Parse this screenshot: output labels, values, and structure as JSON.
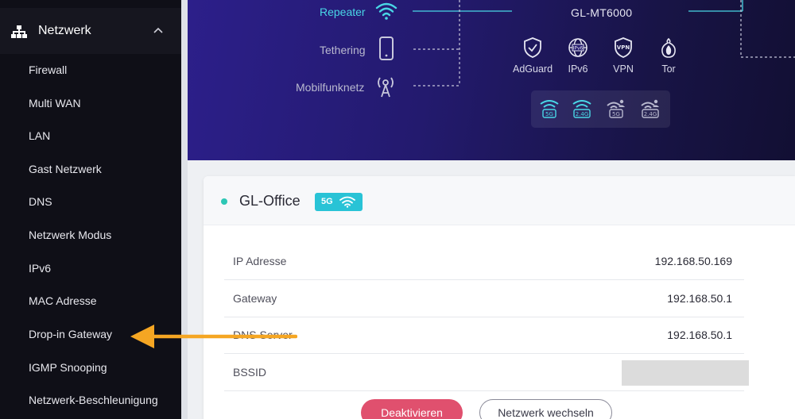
{
  "sidebar": {
    "section_title": "Netzwerk",
    "items": [
      {
        "label": "Firewall"
      },
      {
        "label": "Multi WAN"
      },
      {
        "label": "LAN"
      },
      {
        "label": "Gast Netzwerk"
      },
      {
        "label": "DNS"
      },
      {
        "label": "Netzwerk Modus"
      },
      {
        "label": "IPv6"
      },
      {
        "label": "MAC Adresse"
      },
      {
        "label": "Drop-in Gateway"
      },
      {
        "label": "IGMP Snooping"
      },
      {
        "label": "Netzwerk-Beschleunigung"
      }
    ]
  },
  "topology": {
    "modes": [
      {
        "label": "Repeater",
        "state": "active"
      },
      {
        "label": "Tethering",
        "state": "inactive"
      },
      {
        "label": "Mobilfunknetz",
        "state": "inactive"
      }
    ],
    "device_name": "GL-MT6000",
    "features": [
      {
        "label": "AdGuard",
        "icon": "shield-check-icon"
      },
      {
        "label": "IPv6",
        "icon": "globe-ipv6-icon"
      },
      {
        "label": "VPN",
        "icon": "vpn-shield-icon"
      },
      {
        "label": "Tor",
        "icon": "onion-icon"
      }
    ],
    "bands": [
      {
        "label": "5G",
        "state": "active",
        "icon": "wifi-5g-icon"
      },
      {
        "label": "2.4G",
        "state": "active",
        "icon": "wifi-24g-icon"
      },
      {
        "label": "5G",
        "state": "guest-off",
        "icon": "guest-wifi-5g-icon"
      },
      {
        "label": "2.4G",
        "state": "guest-off",
        "icon": "guest-wifi-24g-icon"
      }
    ]
  },
  "connection": {
    "ssid": "GL-Office",
    "band_badge": "5G",
    "rows": [
      {
        "key": "IP Adresse",
        "value": "192.168.50.169"
      },
      {
        "key": "Gateway",
        "value": "192.168.50.1"
      },
      {
        "key": "DNS Server",
        "value": "192.168.50.1"
      },
      {
        "key": "BSSID",
        "value": ""
      }
    ],
    "deactivate_label": "Deaktivieren",
    "switch_label": "Netzwerk wechseln"
  },
  "colors": {
    "accent_cyan": "#49d7e6",
    "primary_button": "#e0506e",
    "status_connected": "#2dc7b5",
    "annotation_arrow": "#f5a623"
  }
}
